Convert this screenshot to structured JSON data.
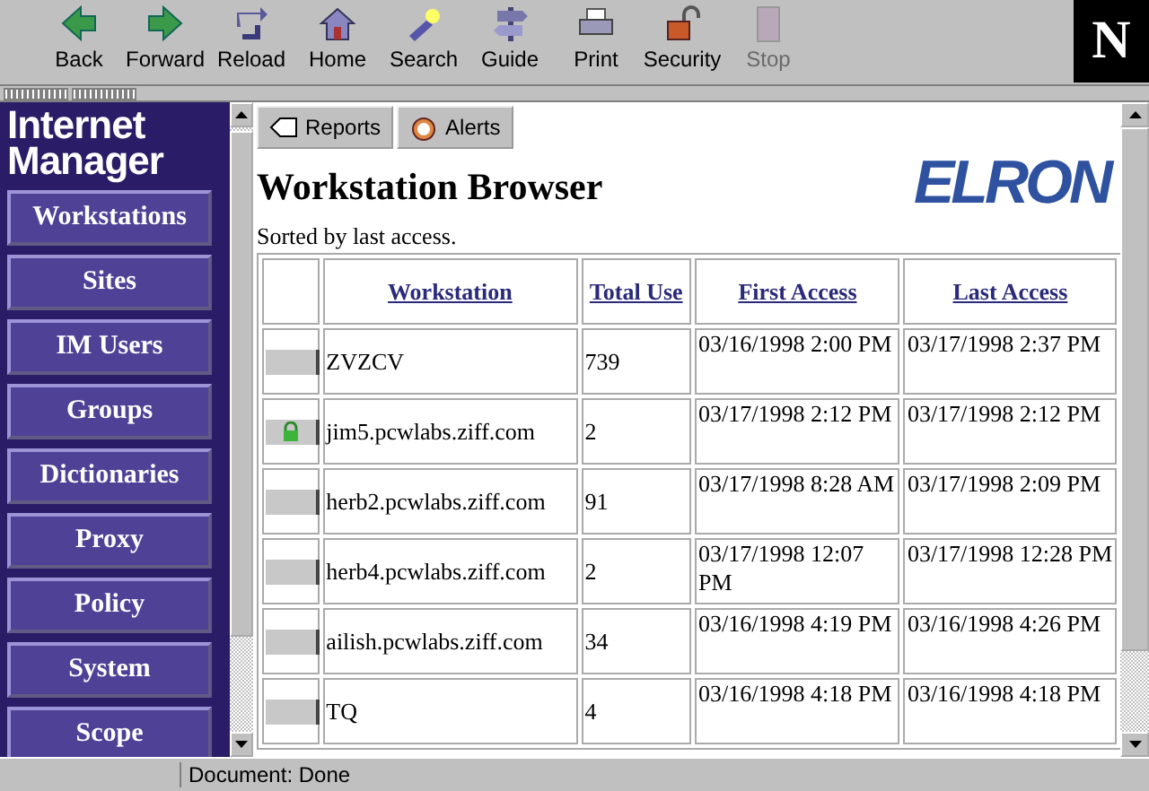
{
  "toolbar": {
    "buttons": [
      {
        "label": "Back",
        "kind": "back",
        "disabled": false
      },
      {
        "label": "Forward",
        "kind": "forward",
        "disabled": false
      },
      {
        "label": "Reload",
        "kind": "reload",
        "disabled": false
      },
      {
        "label": "Home",
        "kind": "home",
        "disabled": false
      },
      {
        "label": "Search",
        "kind": "search",
        "disabled": false
      },
      {
        "label": "Guide",
        "kind": "guide",
        "disabled": false
      },
      {
        "label": "Print",
        "kind": "print",
        "disabled": false
      },
      {
        "label": "Security",
        "kind": "security",
        "disabled": false
      },
      {
        "label": "Stop",
        "kind": "stop",
        "disabled": true
      }
    ],
    "logo": "N"
  },
  "sidebar": {
    "title": "Internet Manager",
    "items": [
      {
        "label": "Workstations"
      },
      {
        "label": "Sites"
      },
      {
        "label": "IM Users"
      },
      {
        "label": "Groups"
      },
      {
        "label": "Dictionaries"
      },
      {
        "label": "Proxy"
      },
      {
        "label": "Policy"
      },
      {
        "label": "System"
      },
      {
        "label": "Scope"
      }
    ]
  },
  "content": {
    "tabs": [
      {
        "label": "Reports",
        "kind": "reports"
      },
      {
        "label": "Alerts",
        "kind": "alerts"
      }
    ],
    "heading": "Workstation Browser",
    "brand": "ELRON",
    "note": "Sorted by last access.",
    "table": {
      "columns": [
        "Workstation",
        "Total Use",
        "First Access",
        "Last Access"
      ],
      "rows": [
        {
          "locked": false,
          "cells": [
            "ZVZCV",
            "739",
            "03/16/1998 2:00 PM",
            "03/17/1998 2:37 PM"
          ]
        },
        {
          "locked": true,
          "cells": [
            "jim5.pcwlabs.ziff.com",
            "2",
            "03/17/1998 2:12 PM",
            "03/17/1998 2:12 PM"
          ]
        },
        {
          "locked": false,
          "cells": [
            "herb2.pcwlabs.ziff.com",
            "91",
            "03/17/1998 8:28 AM",
            "03/17/1998 2:09 PM"
          ]
        },
        {
          "locked": false,
          "cells": [
            "herb4.pcwlabs.ziff.com",
            "2",
            "03/17/1998 12:07 PM",
            "03/17/1998 12:28 PM"
          ]
        },
        {
          "locked": false,
          "cells": [
            "ailish.pcwlabs.ziff.com",
            "34",
            "03/16/1998 4:19 PM",
            "03/16/1998 4:26 PM"
          ]
        },
        {
          "locked": false,
          "cells": [
            "TQ",
            "4",
            "03/16/1998 4:18 PM",
            "03/16/1998 4:18 PM"
          ]
        }
      ]
    }
  },
  "status_bar": {
    "text": "Document: Done"
  }
}
